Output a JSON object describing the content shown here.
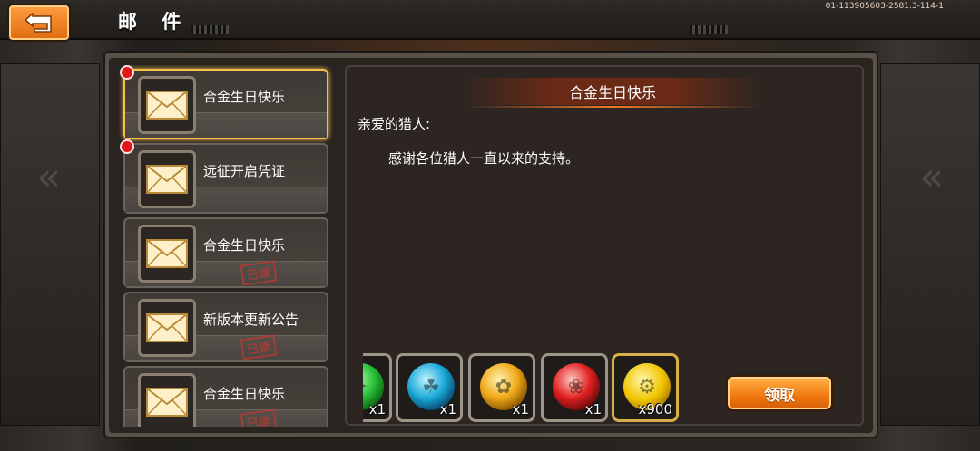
{
  "header": {
    "title": "邮 件",
    "version": "01-113905603-2581.3-114-1",
    "back_icon": "back-arrow-icon"
  },
  "mail_list": [
    {
      "subject": "合金生日快乐",
      "unread": true,
      "selected": true,
      "read_label": ""
    },
    {
      "subject": "远征开启凭证",
      "unread": true,
      "selected": false,
      "read_label": ""
    },
    {
      "subject": "合金生日快乐",
      "unread": false,
      "selected": false,
      "read_label": "已读"
    },
    {
      "subject": "新版本更新公告",
      "unread": false,
      "selected": false,
      "read_label": "已读"
    },
    {
      "subject": "合金生日快乐",
      "unread": false,
      "selected": false,
      "read_label": "已读"
    }
  ],
  "mail_detail": {
    "title": "合金生日快乐",
    "greeting": "亲爱的猎人:",
    "body": "感谢各位猎人一直以来的支持。"
  },
  "rewards": [
    {
      "type": "green-gem",
      "count": "x1"
    },
    {
      "type": "blue-gem",
      "count": "x1"
    },
    {
      "type": "yellow-gem",
      "count": "x1"
    },
    {
      "type": "red-gem",
      "count": "x1"
    },
    {
      "type": "gold-coin",
      "count": "x900"
    }
  ],
  "actions": {
    "claim_label": "领取"
  },
  "colors": {
    "accent_orange": "#f07810",
    "selected_border": "#f6c24a",
    "unread_dot": "#e01818",
    "read_stamp": "#b23a33"
  }
}
